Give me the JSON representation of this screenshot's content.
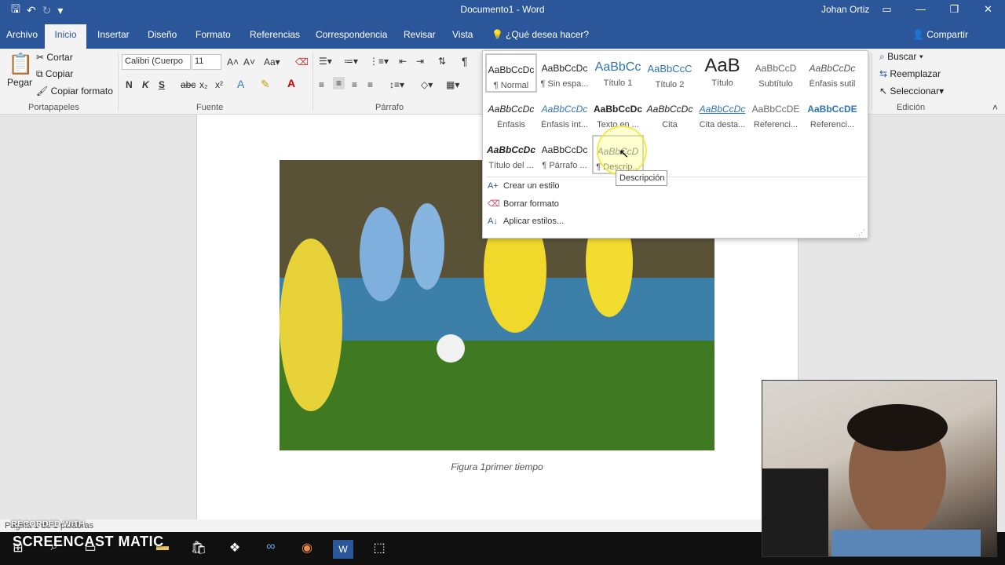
{
  "window": {
    "title": "Documento1 - Word",
    "user": "Johan Ortiz"
  },
  "tabs": [
    "Archivo",
    "Inicio",
    "Insertar",
    "Diseño",
    "Formato",
    "Referencias",
    "Correspondencia",
    "Revisar",
    "Vista"
  ],
  "tell_me": "¿Qué desea hacer?",
  "share": "Compartir",
  "clipboard": {
    "paste": "Pegar",
    "cut": "Cortar",
    "copy": "Copiar",
    "format_painter": "Copiar formato",
    "label": "Portapapeles"
  },
  "font": {
    "name": "Calibri (Cuerpo",
    "size": "11",
    "label": "Fuente",
    "bold": "N",
    "italic": "K",
    "underline": "S"
  },
  "paragraph": {
    "label": "Párrafo"
  },
  "editing": {
    "find": "Buscar",
    "replace": "Reemplazar",
    "select": "Seleccionar",
    "label": "Edición"
  },
  "styles": [
    {
      "preview": "AaBbCcDc",
      "name": "¶ Normal"
    },
    {
      "preview": "AaBbCcDc",
      "name": "¶ Sin espa..."
    },
    {
      "preview": "AaBbCc",
      "name": "Título 1"
    },
    {
      "preview": "AaBbCcC",
      "name": "Título 2"
    },
    {
      "preview": "AaB",
      "name": "Título"
    },
    {
      "preview": "AaBbCcD",
      "name": "Subtítulo"
    },
    {
      "preview": "AaBbCcDc",
      "name": "Énfasis sutil"
    },
    {
      "preview": "AaBbCcDc",
      "name": "Énfasis"
    },
    {
      "preview": "AaBbCcDc",
      "name": "Énfasis int..."
    },
    {
      "preview": "AaBbCcDc",
      "name": "Texto en ..."
    },
    {
      "preview": "AaBbCcDc",
      "name": "Cita"
    },
    {
      "preview": "AaBbCcDc",
      "name": "Cita desta..."
    },
    {
      "preview": "AaBbCcDE",
      "name": "Referenci..."
    },
    {
      "preview": "AaBbCcDE",
      "name": "Referenci..."
    },
    {
      "preview": "AaBbCcDc",
      "name": "Título del ..."
    },
    {
      "preview": "AaBbCcDc",
      "name": "¶ Párrafo ..."
    },
    {
      "preview": "AaBbCcD",
      "name": "¶ Descrip..."
    }
  ],
  "gallery_menu": [
    "Crear un estilo",
    "Borrar formato",
    "Aplicar estilos..."
  ],
  "tooltip": "Descripción",
  "caption": "Figura 1primer tiempo",
  "status": "Página 1 de 1   palabras",
  "watermark": {
    "recorded": "RECORDED WITH",
    "logo": "SCREENCAST  MATIC"
  },
  "colors": {
    "accent": "#2b579a",
    "ribbon": "#f3f3f3"
  }
}
